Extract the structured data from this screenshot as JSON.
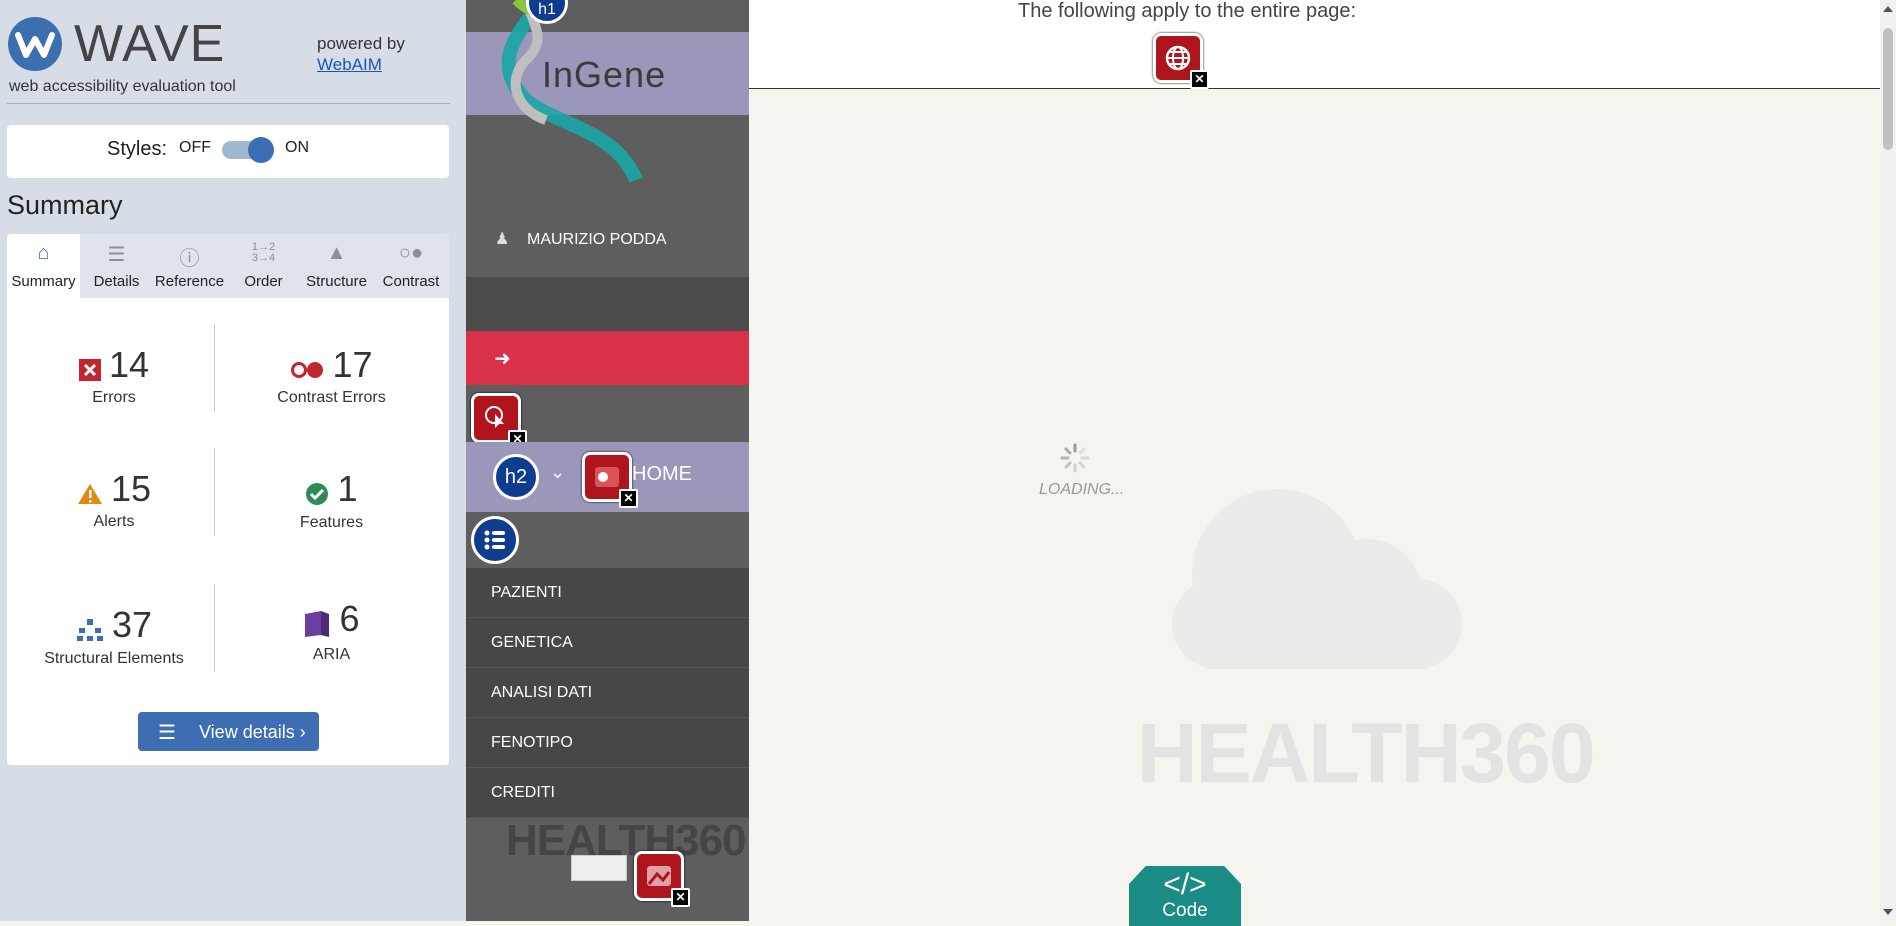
{
  "wave": {
    "brand": "WAVE",
    "tagline": "web accessibility evaluation tool",
    "powered_by": "powered by",
    "webaim_link": "WebAIM",
    "styles": {
      "label": "Styles:",
      "off": "OFF",
      "on": "ON",
      "state": "on"
    },
    "summary_title": "Summary",
    "tabs": [
      {
        "label": "Summary",
        "icon": "home-icon"
      },
      {
        "label": "Details",
        "icon": "list-icon"
      },
      {
        "label": "Reference",
        "icon": "info-icon"
      },
      {
        "label": "Order",
        "icon": "order-icon"
      },
      {
        "label": "Structure",
        "icon": "structure-icon"
      },
      {
        "label": "Contrast",
        "icon": "contrast-icon"
      }
    ],
    "stats": {
      "errors": {
        "count": "14",
        "label": "Errors"
      },
      "contrast": {
        "count": "17",
        "label": "Contrast Errors"
      },
      "alerts": {
        "count": "15",
        "label": "Alerts"
      },
      "features": {
        "count": "1",
        "label": "Features"
      },
      "structural": {
        "count": "37",
        "label": "Structural Elements"
      },
      "aria": {
        "count": "6",
        "label": "ARIA"
      }
    },
    "view_details": "View details ›",
    "colors": {
      "accent": "#3d6db3",
      "error": "#c0262d",
      "alert": "#e08a10",
      "feature": "#2e8b57",
      "aria": "#6b3fa0"
    }
  },
  "nav": {
    "logo_text": "InGene",
    "h1_badge": "h1",
    "user_name": "MAURIZIO PODDA",
    "h2_badge": "h2",
    "home_label": "HOME",
    "menu": [
      "PAZIENTI",
      "GENETICA",
      "ANALISI DATI",
      "FENOTIPO",
      "CREDITI"
    ],
    "footer_logo": "HEALTH360",
    "colors": {
      "logout": "#d9314a",
      "band": "#9b97ba"
    }
  },
  "main": {
    "notice": "The following apply to the entire page:",
    "loading": "LOADING...",
    "brand_watermark": "HEALTH360",
    "code_button": {
      "symbol": "</>",
      "label": "Code"
    }
  }
}
